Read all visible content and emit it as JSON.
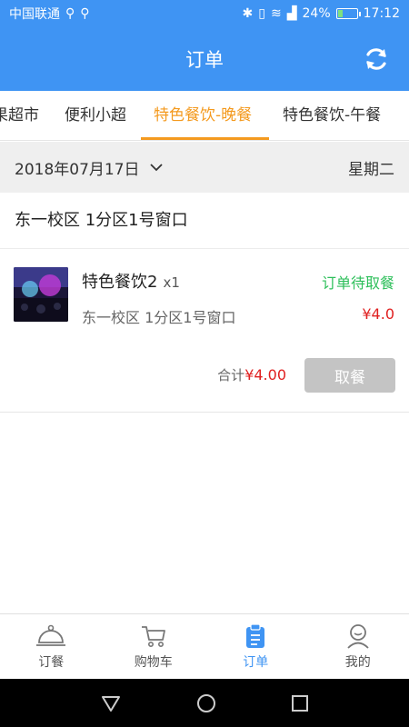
{
  "status_bar": {
    "carrier": "中国联通",
    "battery_percent": "24%",
    "time": "17:12",
    "battery_level": 0.24
  },
  "app_bar": {
    "title": "订单"
  },
  "tabs": [
    {
      "label": "果超市",
      "active": false
    },
    {
      "label": "便利小超",
      "active": false
    },
    {
      "label": "特色餐饮-晚餐",
      "active": true
    },
    {
      "label": "特色餐饮-午餐",
      "active": false
    }
  ],
  "date_bar": {
    "date": "2018年07月17日",
    "weekday": "星期二"
  },
  "order": {
    "location_header": "东一校区  1分区1号窗口",
    "item": {
      "name": "特色餐饮2",
      "qty": "x1",
      "status": "订单待取餐",
      "location": "东一校区 1分区1号窗口",
      "price": "¥4.0"
    },
    "total_label": "合计",
    "total_value": "¥4.00",
    "pickup_button": "取餐"
  },
  "bottom_nav": [
    {
      "label": "订餐",
      "icon": "cloche-icon",
      "active": false
    },
    {
      "label": "购物车",
      "icon": "cart-icon",
      "active": false
    },
    {
      "label": "订单",
      "icon": "clipboard-icon",
      "active": true
    },
    {
      "label": "我的",
      "icon": "profile-icon",
      "active": false
    }
  ],
  "colors": {
    "primary": "#3f94f3",
    "accent": "#f49a1f",
    "status_green": "#2dbf5a",
    "price_red": "#e02020"
  }
}
